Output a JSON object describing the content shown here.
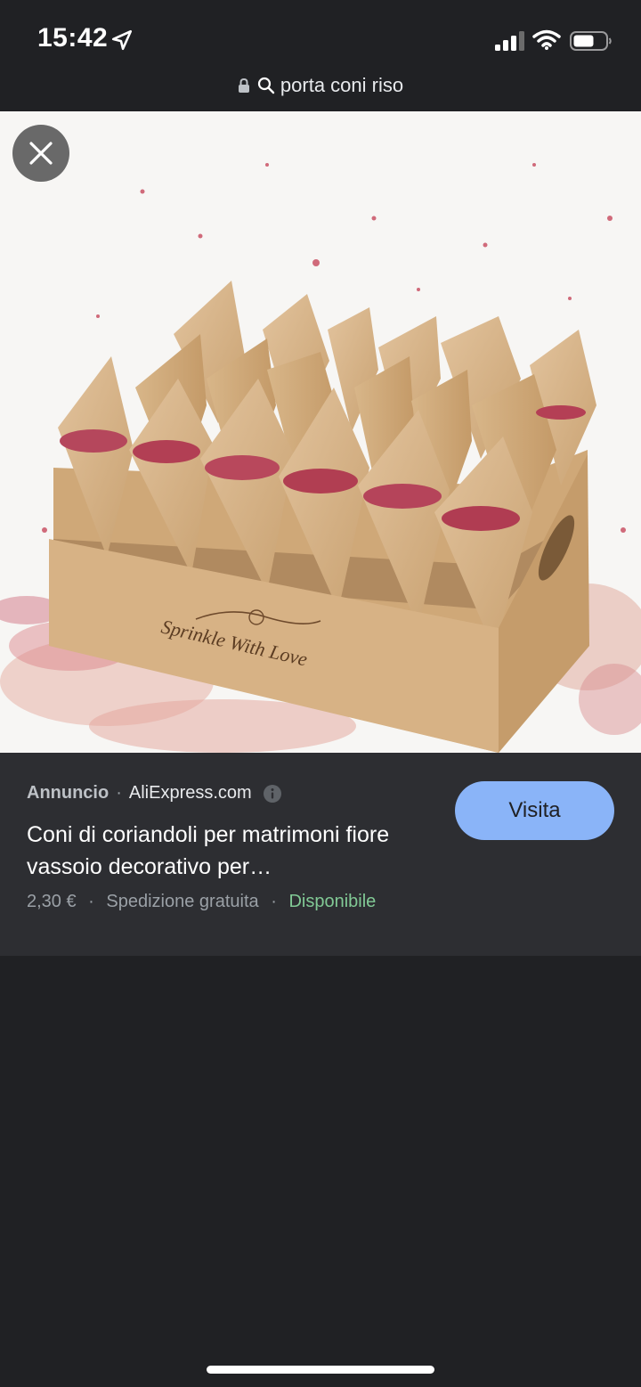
{
  "status_bar": {
    "time": "15:42",
    "icons": [
      "location-arrow-icon",
      "cellular-signal-icon",
      "wifi-icon",
      "battery-icon"
    ]
  },
  "url_bar": {
    "query": "porta coni riso",
    "icons": [
      "lock-icon",
      "search-icon"
    ]
  },
  "image_viewer": {
    "close_icon": "close-icon",
    "image_text": "Sprinkle With Love"
  },
  "ad": {
    "label": "Annuncio",
    "separator": "·",
    "domain": "AliExpress.com",
    "info_icon": "info-icon",
    "title": "Coni di coriandoli per matrimoni fiore vassoio decorativo per…",
    "price": "2,30 €",
    "shipping": "Spedizione gratuita",
    "availability": "Disponibile",
    "visit_label": "Visita"
  },
  "colors": {
    "background": "#202124",
    "panel": "#2d2e32",
    "accent_button": "#8ab4f8",
    "availability": "#81c995",
    "secondary_text": "#9aa0a6"
  }
}
